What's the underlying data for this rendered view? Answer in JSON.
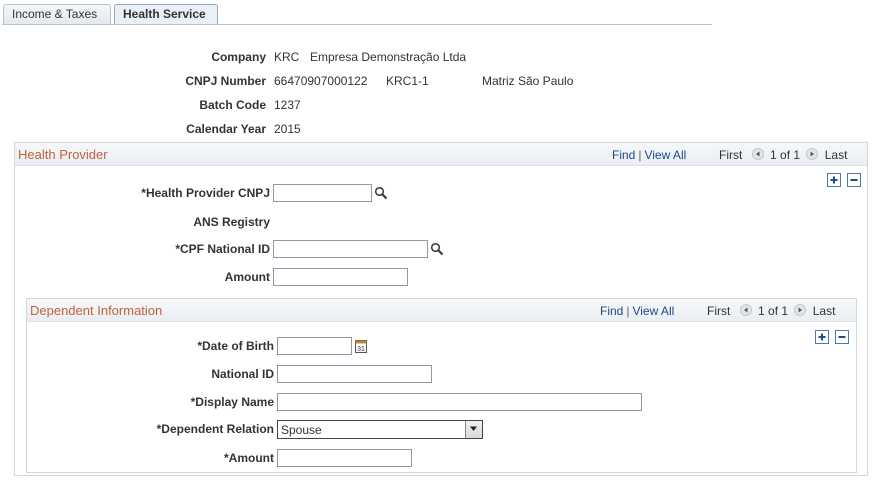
{
  "tabs": [
    {
      "label": "Income & Taxes",
      "active": false
    },
    {
      "label": "Health Service",
      "active": true
    }
  ],
  "header": {
    "company_label": "Company",
    "company_code": "KRC",
    "company_name": "Empresa Demonstração Ltda",
    "cnpj_label": "CNPJ Number",
    "cnpj_value": "66470907000122",
    "cnpj_code": "KRC1-1",
    "cnpj_desc": "Matriz São Paulo",
    "batch_label": "Batch Code",
    "batch_value": "1237",
    "year_label": "Calendar Year",
    "year_value": "2015"
  },
  "health_provider": {
    "title": "Health Provider",
    "find": "Find",
    "view_all": "View All",
    "first": "First",
    "count": "1 of 1",
    "last": "Last",
    "cnpj_label": "*Health Provider CNPJ",
    "cnpj_value": "",
    "ans_label": "ANS Registry",
    "cpf_label": "*CPF National ID",
    "cpf_value": "",
    "amount_label": "Amount",
    "amount_value": ""
  },
  "dependent": {
    "title": "Dependent Information",
    "find": "Find",
    "view_all": "View All",
    "first": "First",
    "count": "1 of 1",
    "last": "Last",
    "dob_label": "*Date of Birth",
    "dob_value": "",
    "natid_label": "National ID",
    "natid_value": "",
    "name_label": "*Display Name",
    "name_value": "",
    "relation_label": "*Dependent Relation",
    "relation_value": "Spouse",
    "amount_label": "*Amount",
    "amount_value": ""
  },
  "icons": {
    "lookup": "magnifier-icon",
    "calendar": "calendar-icon",
    "add": "plus-icon",
    "delete": "minus-icon",
    "prev": "left-arrow-icon",
    "next": "right-arrow-icon"
  },
  "colors": {
    "section_title": "#c0623a",
    "link": "#1a4a8a",
    "tab_active_bg": "#e9f0f7"
  }
}
